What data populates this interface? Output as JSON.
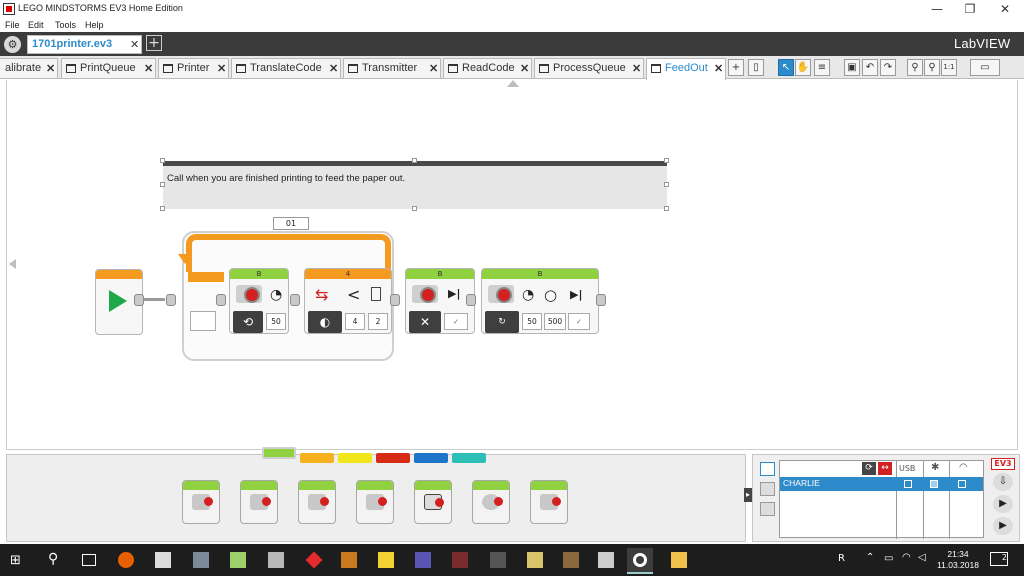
{
  "window": {
    "title": "LEGO MINDSTORMS EV3 Home Edition",
    "controls": {
      "minimize": "—",
      "restore": "❐",
      "close": "✕"
    }
  },
  "menu": [
    "File",
    "Edit",
    "Tools",
    "Help"
  ],
  "project": {
    "tab_label": "1701printer.ev3",
    "close": "✕",
    "add": "+",
    "brand": "LabVIEW"
  },
  "program_tabs": [
    {
      "label": "alibrate"
    },
    {
      "label": "PrintQueue"
    },
    {
      "label": "Printer"
    },
    {
      "label": "TranslateCode"
    },
    {
      "label": "Transmitter"
    },
    {
      "label": "ReadCode"
    },
    {
      "label": "ProcessQueue"
    },
    {
      "label": "FeedOut",
      "active": true
    }
  ],
  "toolbar_icons": [
    "add-tab-icon",
    "content-editor-icon",
    "pointer-icon",
    "pan-icon",
    "comment-icon",
    "save-icon",
    "undo-icon",
    "redo-icon",
    "zoom-in-icon",
    "zoom-out-icon",
    "zoom-reset-icon",
    "content-editor-toggle-icon"
  ],
  "comment": {
    "text": "Call when you are finished printing to feed the paper out."
  },
  "program": {
    "loop_label": "01",
    "blocks": [
      {
        "name": "motor-block-1",
        "port": "B",
        "params": [
          "50"
        ]
      },
      {
        "name": "compare-block",
        "port": "4",
        "params": [
          "4",
          "2"
        ]
      },
      {
        "name": "motor-block-2",
        "port": "B",
        "params": []
      },
      {
        "name": "motor-block-3",
        "port": "B",
        "params": [
          "50",
          "500"
        ]
      }
    ]
  },
  "palette_colors": [
    "#8fd13f",
    "#f5b11e",
    "#f0e61a",
    "#d62a14",
    "#1e74c9",
    "#2bbfb8"
  ],
  "palette_blocks": [
    "medium-motor-icon",
    "large-motor-icon",
    "move-steering-icon",
    "move-tank-icon",
    "display-icon",
    "sound-icon",
    "brick-status-light-icon"
  ],
  "hardware": {
    "brick_name": "CHARLIE",
    "usb_label": "USB",
    "ev3_label": "EV3"
  },
  "taskbar": {
    "time": "21:34",
    "date": "11.03.2018",
    "notifications": "2",
    "lang": "R"
  }
}
